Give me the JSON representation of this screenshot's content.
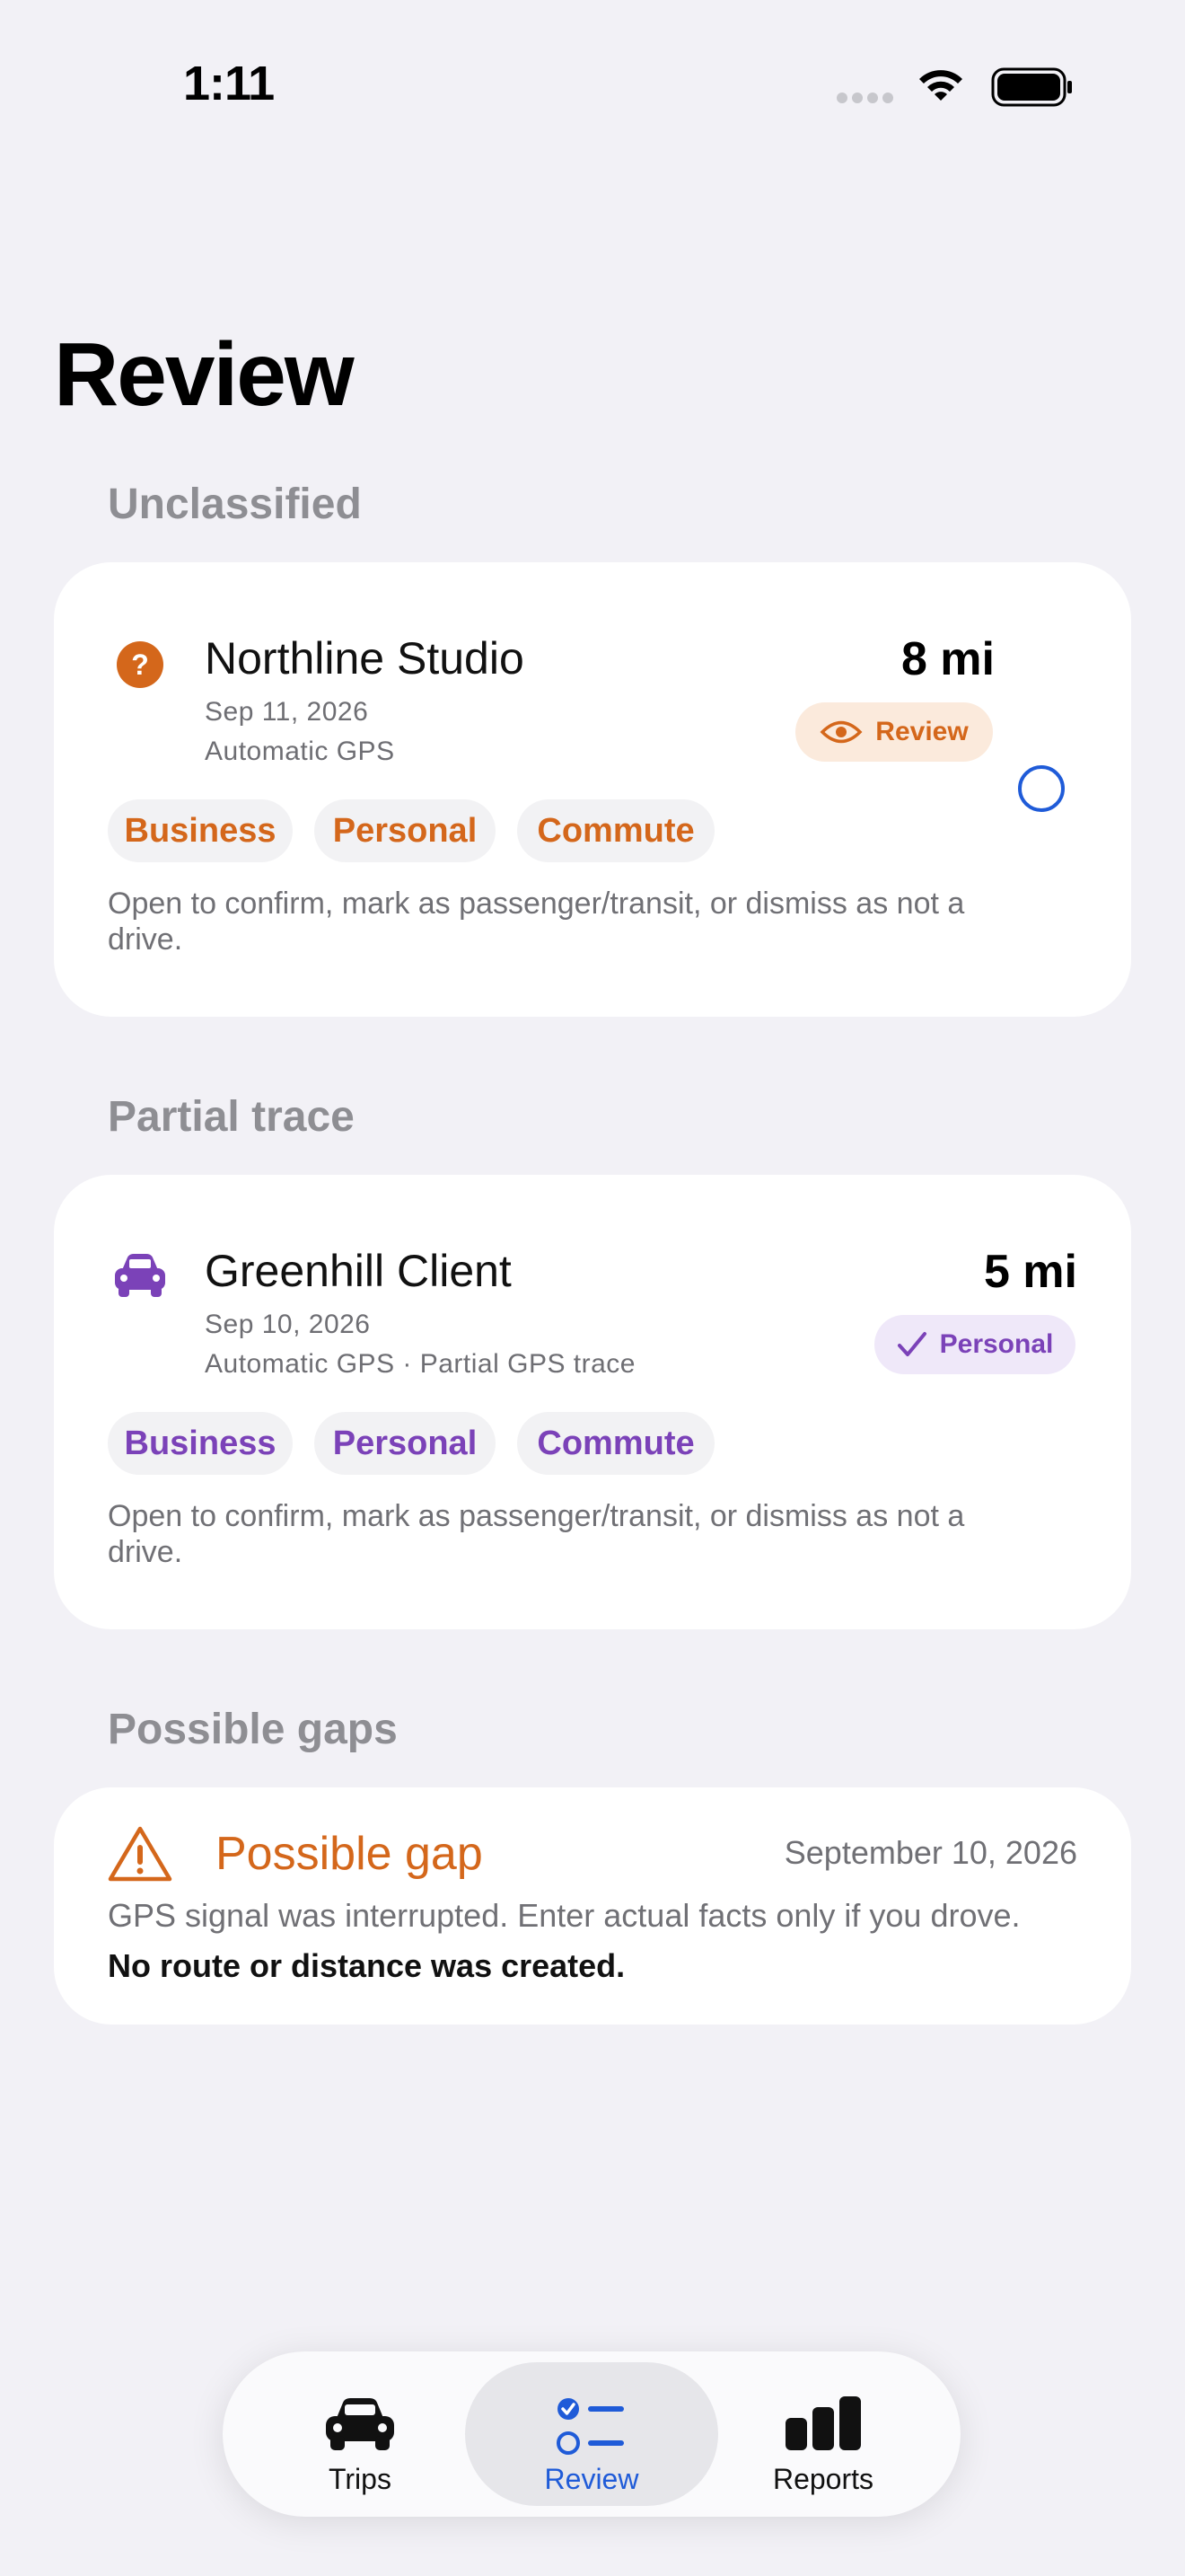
{
  "status_bar": {
    "time": "1:11"
  },
  "page": {
    "title": "Review"
  },
  "sections": {
    "unclassified": {
      "label": "Unclassified",
      "trip": {
        "title": "Northline Studio",
        "date": "Sep 11, 2026",
        "source": "Automatic GPS",
        "distance": "8 mi",
        "status": "Review",
        "chips": [
          "Business",
          "Personal",
          "Commute"
        ],
        "hint": "Open to confirm, mark as passenger/transit, or dismiss as not a drive.",
        "accent": "#D4671B"
      }
    },
    "partial": {
      "label": "Partial trace",
      "trip": {
        "title": "Greenhill Client",
        "date": "Sep 10, 2026",
        "source": "Automatic GPS · Partial GPS trace",
        "distance": "5 mi",
        "status": "Personal",
        "chips": [
          "Business",
          "Personal",
          "Commute"
        ],
        "hint": "Open to confirm, mark as passenger/transit, or dismiss as not a drive.",
        "accent": "#7B42B8"
      }
    },
    "gaps": {
      "label": "Possible gaps",
      "gap": {
        "title": "Possible gap",
        "date": "September 10, 2026",
        "description": "GPS signal was interrupted. Enter actual facts only if you drove.",
        "note": "No route or distance was created."
      }
    }
  },
  "tabbar": {
    "tabs": [
      {
        "label": "Trips",
        "icon": "car-icon",
        "active": false
      },
      {
        "label": "Review",
        "icon": "checklist-icon",
        "active": true
      },
      {
        "label": "Reports",
        "icon": "bar-chart-icon",
        "active": false
      }
    ],
    "active_color": "#1F5BD8"
  }
}
